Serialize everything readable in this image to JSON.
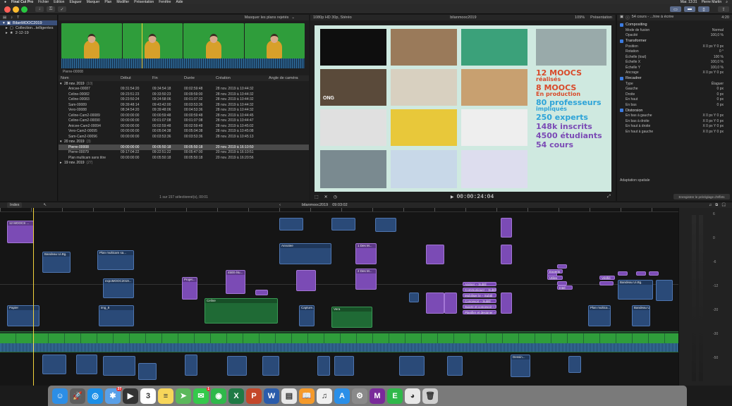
{
  "menubar": {
    "app": "Final Cut Pro",
    "items": [
      "Fichier",
      "Édition",
      "Élaguer",
      "Marquer",
      "Plan",
      "Modifier",
      "Présentation",
      "Fenêtre",
      "Aide"
    ],
    "clock": "Mar. 13:31",
    "user": "Pierre Martin"
  },
  "library": {
    "items": [
      {
        "label": "BilanMOOC2019",
        "selected": true
      },
      {
        "label": "Collection...telligentes",
        "selected": false
      },
      {
        "label": "2-12-19",
        "selected": false
      }
    ]
  },
  "browser": {
    "filter_label": "Masquer les plans rejetés",
    "clip_title": "Pierre-00008",
    "columns": [
      "Nom",
      "Début",
      "Fin",
      "Durée",
      "Création",
      "Angle de caméra"
    ],
    "groups": [
      {
        "label": "28 nov. 2019",
        "count": "(10)",
        "rows": [
          [
            "Anicee-00087",
            "09:31:54:20",
            "09:34:54:18",
            "00:02:59:48",
            "28 nov. 2019 à 10:44:32"
          ],
          [
            "Celine-00082",
            "09:23:51:23",
            "09:33:50:23",
            "00:09:59:00",
            "28 nov. 2019 à 10:44:32"
          ],
          [
            "Celine-00083",
            "09:23:50:24",
            "09:24:58:06",
            "00:01:07:32",
            "28 nov. 2019 à 10:44:32"
          ],
          [
            "Sam-00089",
            "09:39:48:14",
            "09:43:42:00",
            "00:03:53:36",
            "28 nov. 2019 à 10:44:32"
          ],
          [
            "Vero-00088",
            "08:34:54:20",
            "09:39:48:06",
            "00:04:53:36",
            "28 nov. 2019 à 10:44:32"
          ],
          [
            "Celine-Cam2-00089",
            "00:00:00:00",
            "00:00:59:48",
            "00:00:59:48",
            "28 nov. 2019 à 10:44:45"
          ],
          [
            "Celine-Cam2-00090",
            "00:00:00:00",
            "00:01:07:08",
            "00:01:07:08",
            "28 nov. 2019 à 10:44:47"
          ],
          [
            "Anicee-Cam2-00094",
            "00:00:00:00",
            "00:02:59:48",
            "00:02:59:48",
            "28 nov. 2019 à 10:45:02"
          ],
          [
            "Vero-Cam2-00095",
            "00:00:00:00",
            "00:05:04:38",
            "00:05:04:38",
            "28 nov. 2019 à 10:45:08"
          ],
          [
            "Sam-Cam2-00096",
            "00:00:00:00",
            "00:03:53:36",
            "00:03:53:36",
            "28 nov. 2019 à 10:45:13"
          ]
        ]
      },
      {
        "label": "20 nov. 2019",
        "count": "(3)",
        "rows": [
          [
            "Pierre-00008",
            "00:00:00:00",
            "00:05:50:18",
            "00:05:50:18",
            "20 nov. 2019 à 16:10:50"
          ],
          [
            "Pierre-00079",
            "09:17:04:22",
            "09:22:51:22",
            "00:05:47:00",
            "20 nov. 2019 à 16:10:51"
          ],
          [
            "Plan multicam sans titre",
            "00:00:00:00",
            "00:05:50:18",
            "00:05:50:18",
            "20 nov. 2019 à 16:20:56"
          ]
        ]
      },
      {
        "label": "19 nov. 2019",
        "count": "(27)",
        "rows": []
      }
    ],
    "status": "1 sur 157 sélectionné(s), 00:01"
  },
  "viewer": {
    "format": "1080p HD 30p, Stéréo",
    "title": "bilanmooc2019",
    "zoom": "109%",
    "view_label": "Présentation",
    "timecode": "00:00:24:04",
    "stats": [
      {
        "big": "12 MOOCS",
        "small": "réalisés",
        "color": "#d94a2a"
      },
      {
        "big": "8 MOOCS",
        "small": "En production",
        "color": "#d94a2a"
      },
      {
        "big": "80 professeurs",
        "small": "impliqués",
        "color": "#2da3d8"
      },
      {
        "big": "250 experts",
        "small": "",
        "color": "#2da3d8"
      },
      {
        "big": "148k inscrits",
        "small": "",
        "color": "#7b4bb5"
      },
      {
        "big": "4500 étudiants",
        "small": "",
        "color": "#7b4bb5"
      },
      {
        "big": "54 cours",
        "small": "",
        "color": "#7b4bb5"
      }
    ],
    "tile_caption": "ONG"
  },
  "inspector": {
    "header": "54 cours - ...hire à écrire",
    "duration": "4:20",
    "sections": [
      {
        "title": "Compositing",
        "rows": [
          [
            "Mode de fusion",
            "Normal"
          ],
          [
            "Opacité",
            "100,0 %"
          ]
        ]
      },
      {
        "title": "Transformer",
        "rows": [
          [
            "Position",
            "X  0 px   Y  0 px"
          ],
          [
            "Rotation",
            "0 °"
          ],
          [
            "Échelle (tout)",
            "100 %"
          ],
          [
            "Échelle X",
            "100,0 %"
          ],
          [
            "Échelle Y",
            "100,0 %"
          ],
          [
            "Ancrage",
            "X  0 px   Y  0 px"
          ]
        ]
      },
      {
        "title": "Recadrer",
        "rows": [
          [
            "Type",
            "Élaguer"
          ],
          [
            "Gauche",
            "0 px"
          ],
          [
            "Droite",
            "0 px"
          ],
          [
            "En haut",
            "0 px"
          ],
          [
            "En bas",
            "0 px"
          ]
        ]
      },
      {
        "title": "Distorsion",
        "rows": [
          [
            "En bas à gauche",
            "X 0 px  Y 0 px"
          ],
          [
            "En bas à droite",
            "X 0 px  Y 0 px"
          ],
          [
            "En haut à droite",
            "X 0 px  Y 0 px"
          ],
          [
            "En haut à gauche",
            "X 0 px  Y 0 px"
          ]
        ]
      }
    ],
    "spatial": "Adaptation spatiale",
    "save_effects": "Enregistrer le préréglage d'effets"
  },
  "timeline": {
    "index_label": "Index",
    "project": "bilanmooc2019",
    "duration": "09:03:02",
    "meter_labels": [
      "6",
      "0",
      "-6",
      "-12",
      "-20",
      "-30",
      "-50"
    ],
    "clips": [
      {
        "label": "12 MOOCS ...",
        "color": "purple"
      },
      {
        "label": "Bandeau Ui.Bg.",
        "color": "blue"
      },
      {
        "label": "Plan multicam sa...",
        "color": "blue"
      },
      {
        "label": "expoMOOC2019...",
        "color": "blue"
      },
      {
        "label": "Celine",
        "color": "green"
      },
      {
        "label": "Annotee",
        "color": "blue"
      },
      {
        "label": "1 Des M...",
        "color": "purple"
      },
      {
        "label": "2 Des M...",
        "color": "purple"
      },
      {
        "label": "4500 étu...",
        "color": "purple"
      },
      {
        "label": "Vera",
        "color": "green"
      },
      {
        "label": "Projet...",
        "color": "purple"
      },
      {
        "label": "Bandeau Ui.Bg.",
        "color": "blue"
      },
      {
        "label": "Plan multica...",
        "color": "blue"
      },
      {
        "label": "Papier",
        "color": "blue"
      },
      {
        "label": "img_8",
        "color": "blue"
      },
      {
        "label": "Bandeau Ui.Bg.",
        "color": "blue"
      },
      {
        "label": "Capture...",
        "color": "blue"
      },
      {
        "label": "Dessin...",
        "color": "blue"
      }
    ],
    "titles": [
      "Animer – Subtil",
      "Communiquer – Subtil",
      "Mobiliser le – Subtil",
      "Concevoir – Subtil",
      "Suivre et concevoir – Subtil",
      "Planifier et designer – Subtil",
      "Experts",
      "Utiles",
      "Intel",
      "Vérifié"
    ]
  },
  "dock": {
    "apps": [
      {
        "name": "finder-icon",
        "color": "#2d8ee6",
        "glyph": "☺"
      },
      {
        "name": "launchpad-icon",
        "color": "#5e5e5e",
        "glyph": "🚀"
      },
      {
        "name": "safari-icon",
        "color": "#1b8fe8",
        "glyph": "◎"
      },
      {
        "name": "photos-icon",
        "color": "#5aa0e8",
        "glyph": "✱"
      },
      {
        "name": "fcp-icon",
        "color": "#333",
        "glyph": "▶"
      },
      {
        "name": "calendar-icon",
        "color": "#fff",
        "glyph": "3"
      },
      {
        "name": "notes-icon",
        "color": "#f7d65a",
        "glyph": "≡"
      },
      {
        "name": "maps-icon",
        "color": "#5bb85b",
        "glyph": "➤"
      },
      {
        "name": "messages-icon",
        "color": "#35c94b",
        "glyph": "✉"
      },
      {
        "name": "facetime-icon",
        "color": "#2fb84a",
        "glyph": "◉"
      },
      {
        "name": "excel-icon",
        "color": "#1f7a45",
        "glyph": "X"
      },
      {
        "name": "powerpoint-icon",
        "color": "#c4472a",
        "glyph": "P"
      },
      {
        "name": "word-icon",
        "color": "#2a5cab",
        "glyph": "W"
      },
      {
        "name": "preview-icon",
        "color": "#e8e8e8",
        "glyph": "▤"
      },
      {
        "name": "books-icon",
        "color": "#f59a2a",
        "glyph": "📖"
      },
      {
        "name": "music-icon",
        "color": "#f0f0f0",
        "glyph": "♫"
      },
      {
        "name": "appstore-icon",
        "color": "#2a8fe8",
        "glyph": "A"
      },
      {
        "name": "settings-icon",
        "color": "#8a8a8a",
        "glyph": "⚙"
      },
      {
        "name": "motion-icon",
        "color": "#7a2a9a",
        "glyph": "M"
      },
      {
        "name": "evernote-icon",
        "color": "#2fb84a",
        "glyph": "E"
      },
      {
        "name": "chrome-icon",
        "color": "#e8e8e8",
        "glyph": "◕"
      },
      {
        "name": "trash-icon",
        "color": "#d0d0d0",
        "glyph": "🗑"
      }
    ],
    "calendar_day": "3",
    "badge_mail": "37",
    "badge_msg": "1"
  }
}
